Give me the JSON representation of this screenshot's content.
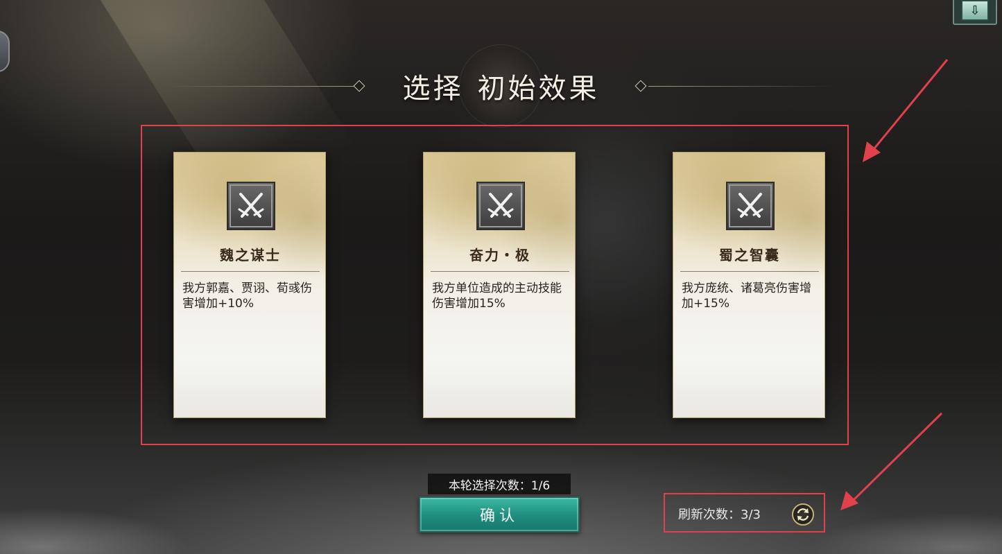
{
  "title": {
    "part1": "选择",
    "part2": "初始效果"
  },
  "cards": [
    {
      "name": "魏之谋士",
      "description": "我方郭嘉、贾诩、荀彧伤害增加+10%",
      "icon": "crossed-swords-icon"
    },
    {
      "name": "奋力・极",
      "description": "我方单位造成的主动技能伤害增加15%",
      "icon": "crossed-swords-icon"
    },
    {
      "name": "蜀之智囊",
      "description": "我方庞统、诸葛亮伤害增加+15%",
      "icon": "crossed-swords-icon"
    }
  ],
  "selection": {
    "count_label": "本轮选择次数：1/6",
    "confirm_label": "确认"
  },
  "refresh": {
    "label": "刷新次数：3/3",
    "icon": "refresh-icon"
  },
  "colors": {
    "highlight": "#e0414b",
    "confirm_button": "#1f8c7e",
    "card_gold": "#d9c795"
  }
}
